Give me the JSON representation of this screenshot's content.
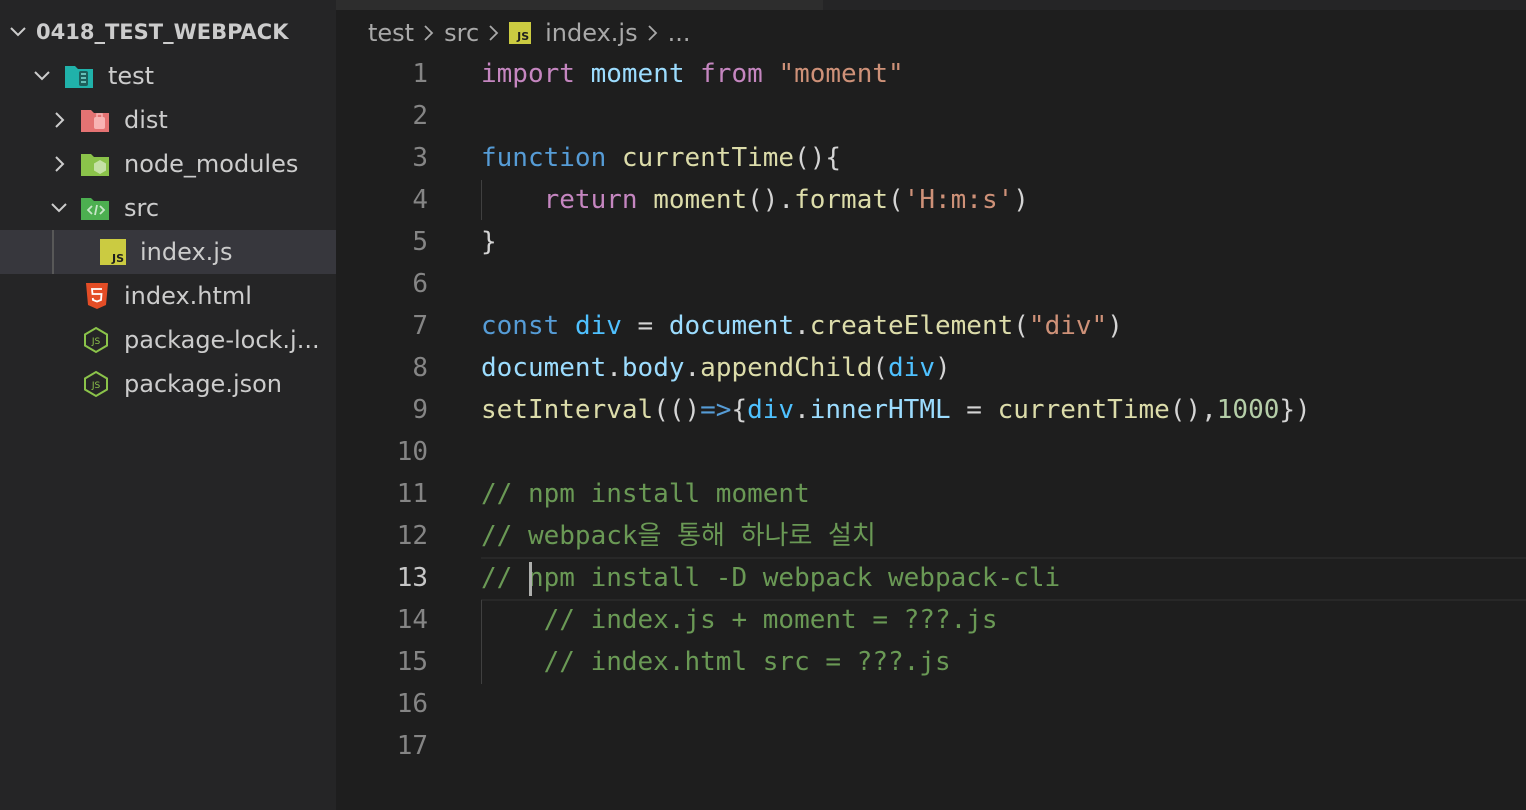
{
  "explorer": {
    "root": {
      "label": "0418_TEST_WEBPACK"
    },
    "items": [
      {
        "label": "test",
        "icon": "folder-test-icon",
        "expanded": true
      },
      {
        "label": "dist",
        "icon": "folder-dist-icon",
        "expanded": false
      },
      {
        "label": "node_modules",
        "icon": "folder-node-icon",
        "expanded": false
      },
      {
        "label": "src",
        "icon": "folder-src-icon",
        "expanded": true
      },
      {
        "label": "index.js",
        "icon": "js-file-icon",
        "selected": true
      },
      {
        "label": "index.html",
        "icon": "html5-file-icon"
      },
      {
        "label": "package-lock.j...",
        "icon": "nodejs-file-icon"
      },
      {
        "label": "package.json",
        "icon": "nodejs-file-icon"
      }
    ]
  },
  "breadcrumb": {
    "items": [
      {
        "label": "test"
      },
      {
        "label": "src"
      },
      {
        "label": "index.js",
        "icon": "js-file-icon"
      },
      {
        "label": "..."
      }
    ]
  },
  "editor": {
    "active_line": 13,
    "line_numbers": [
      "1",
      "2",
      "3",
      "4",
      "5",
      "6",
      "7",
      "8",
      "9",
      "10",
      "11",
      "12",
      "13",
      "14",
      "15",
      "16",
      "17"
    ],
    "lines": [
      [
        {
          "t": "import",
          "c": "kw"
        },
        {
          "t": " ",
          "c": "pn"
        },
        {
          "t": "moment",
          "c": "vr"
        },
        {
          "t": " ",
          "c": "pn"
        },
        {
          "t": "from",
          "c": "kw"
        },
        {
          "t": " ",
          "c": "pn"
        },
        {
          "t": "\"moment\"",
          "c": "st"
        }
      ],
      [],
      [
        {
          "t": "function",
          "c": "kb"
        },
        {
          "t": " ",
          "c": "pn"
        },
        {
          "t": "currentTime",
          "c": "fn"
        },
        {
          "t": "(){",
          "c": "pn"
        }
      ],
      [
        {
          "t": "    ",
          "c": "pn"
        },
        {
          "t": "return",
          "c": "kw"
        },
        {
          "t": " ",
          "c": "pn"
        },
        {
          "t": "moment",
          "c": "fn"
        },
        {
          "t": "().",
          "c": "pn"
        },
        {
          "t": "format",
          "c": "fn"
        },
        {
          "t": "(",
          "c": "pn"
        },
        {
          "t": "'H:m:s'",
          "c": "st"
        },
        {
          "t": ")",
          "c": "pn"
        }
      ],
      [
        {
          "t": "}",
          "c": "pn"
        }
      ],
      [],
      [
        {
          "t": "const",
          "c": "kb"
        },
        {
          "t": " ",
          "c": "pn"
        },
        {
          "t": "div",
          "c": "cn"
        },
        {
          "t": " = ",
          "c": "pn"
        },
        {
          "t": "document",
          "c": "vr"
        },
        {
          "t": ".",
          "c": "pn"
        },
        {
          "t": "createElement",
          "c": "fn"
        },
        {
          "t": "(",
          "c": "pn"
        },
        {
          "t": "\"div\"",
          "c": "st"
        },
        {
          "t": ")",
          "c": "pn"
        }
      ],
      [
        {
          "t": "document",
          "c": "vr"
        },
        {
          "t": ".",
          "c": "pn"
        },
        {
          "t": "body",
          "c": "vr"
        },
        {
          "t": ".",
          "c": "pn"
        },
        {
          "t": "appendChild",
          "c": "fn"
        },
        {
          "t": "(",
          "c": "pn"
        },
        {
          "t": "div",
          "c": "cn"
        },
        {
          "t": ")",
          "c": "pn"
        }
      ],
      [
        {
          "t": "setInterval",
          "c": "fn"
        },
        {
          "t": "(()",
          "c": "pn"
        },
        {
          "t": "=>",
          "c": "kb"
        },
        {
          "t": "{",
          "c": "pn"
        },
        {
          "t": "div",
          "c": "cn"
        },
        {
          "t": ".",
          "c": "pn"
        },
        {
          "t": "innerHTML",
          "c": "vr"
        },
        {
          "t": " = ",
          "c": "pn"
        },
        {
          "t": "currentTime",
          "c": "fn"
        },
        {
          "t": "(),",
          "c": "pn"
        },
        {
          "t": "1000",
          "c": "nm"
        },
        {
          "t": "})",
          "c": "pn"
        }
      ],
      [],
      [
        {
          "t": "// npm install moment",
          "c": "cm"
        }
      ],
      [
        {
          "t": "// webpack을 통해 하나로 설치",
          "c": "cm"
        }
      ],
      [
        {
          "t": "// npm install -D webpack webpack-cli",
          "c": "cm"
        }
      ],
      [
        {
          "t": "    // index.js + moment = ???.js",
          "c": "cm"
        }
      ],
      [
        {
          "t": "    // index.html src = ???.js",
          "c": "cm"
        }
      ],
      [],
      []
    ]
  },
  "colors": {
    "sidebar_bg": "#252526",
    "editor_bg": "#1e1e1e",
    "selected_row": "#37373d",
    "line_number": "#858585",
    "keyword_control": "#c586c0",
    "keyword": "#569cd6",
    "function": "#dcdcaa",
    "variable": "#9cdcfe",
    "constant": "#4fc1ff",
    "string": "#ce9178",
    "comment": "#6a9955",
    "number": "#b5cea8"
  }
}
